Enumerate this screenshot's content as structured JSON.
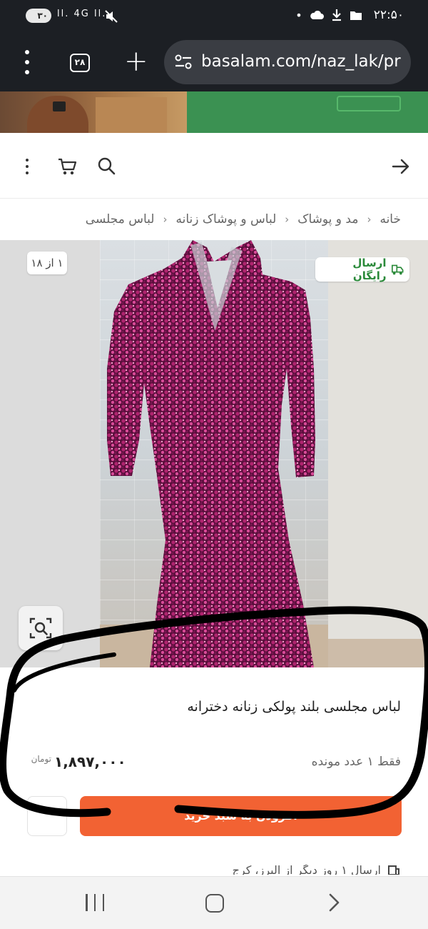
{
  "status_bar": {
    "battery": "۳۰",
    "network_left": "ll. 4G ll.",
    "time": "۲۲:۵۰",
    "icons": [
      "mute-icon",
      "dot-icon",
      "cloud-icon",
      "download-icon",
      "folder-icon"
    ]
  },
  "browser": {
    "tab_count": "۲۸",
    "url": "basalam.com/naz_lak/pr",
    "icons": [
      "menu-icon",
      "tabs-icon",
      "plus-icon",
      "site-settings-icon"
    ]
  },
  "header": {
    "icons": [
      "kebab-icon",
      "cart-icon",
      "search-icon",
      "arrow-right-icon"
    ]
  },
  "breadcrumb": {
    "items": [
      "خانه",
      "مد و پوشاک",
      "لباس و پوشاک زنانه",
      "لباس مجلسی"
    ]
  },
  "gallery": {
    "counter": "۱ از ۱۸",
    "free_shipping": "ارسال رایگان",
    "zoom_icon": "zoom-scan-icon"
  },
  "product": {
    "title": "لباس مجلسی بلند پولکی زنانه دخترانه",
    "stock": "فقط ۱ عدد مونده",
    "price": "۱,۸۹۷,۰۰۰",
    "currency": "تومان",
    "add_to_cart": "افزودن به سبد خرید",
    "delivery": "ارسال ۱ روز دیگر از البرز، کرج"
  },
  "colors": {
    "accent": "#f26233",
    "free_shipping_green": "#2b8a3a",
    "chrome_dark": "#1c1f24"
  },
  "nav": {
    "icons": [
      "recent-apps-icon",
      "home-icon",
      "back-icon"
    ]
  }
}
